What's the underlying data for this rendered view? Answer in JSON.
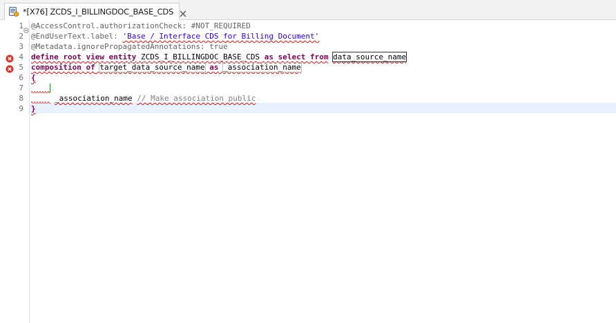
{
  "tab": {
    "title": "*[X76] ZCDS_I_BILLINGDOC_BASE_CDS",
    "icon": "cds-file-icon",
    "close_icon": "close-icon"
  },
  "editor": {
    "line_numbers": [
      "1",
      "2",
      "3",
      "4",
      "5",
      "6",
      "7",
      "8",
      "9"
    ],
    "errors_on_lines": [
      4,
      5
    ],
    "fold_on_line": 1,
    "current_line": 9,
    "lines": {
      "l1": {
        "text": "@AccessControl.authorizationCheck: #NOT_REQUIRED"
      },
      "l2": {
        "prefix": "@EndUserText.label: ",
        "string": "'Base / Interface CDS for Billing Document'"
      },
      "l3": {
        "text": "@Metadata.ignorePropagatedAnnotations: true"
      },
      "l4": {
        "kw1": "define root view entity",
        "name": "ZCDS_I_BILLINGDOC_BASE_CDS",
        "kw2": "as select from",
        "source": "data_source_name"
      },
      "l5": {
        "kw1": "composition of",
        "target": "target_data_source_name",
        "kw2": "as",
        "assoc": "_association_name"
      },
      "l6": {
        "text": "{"
      },
      "l7": {
        "text": ""
      },
      "l8": {
        "field": "_association_name",
        "comment": "// Make association public"
      },
      "l9": {
        "text": "}"
      }
    }
  },
  "colors": {
    "keyword": "#7f0055",
    "string": "#2a00ff",
    "annotation": "#646464",
    "comment": "#808080",
    "error": "#e01010",
    "current_line": "#e8f2fe"
  }
}
